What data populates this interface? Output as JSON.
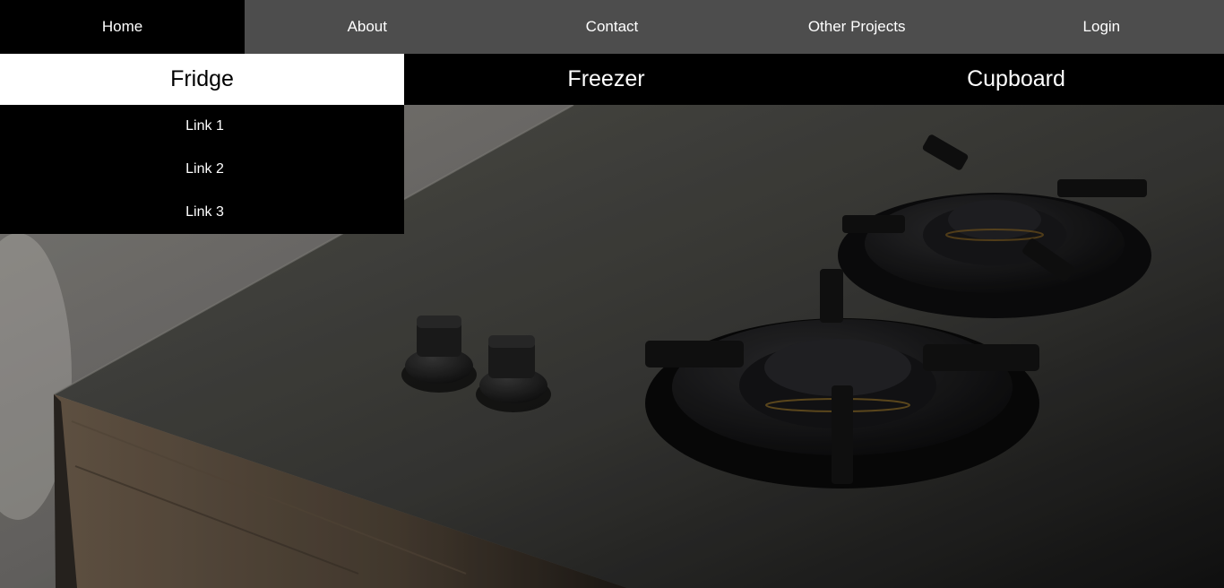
{
  "topnav": {
    "items": [
      {
        "label": "Home",
        "active": true
      },
      {
        "label": "About",
        "active": false
      },
      {
        "label": "Contact",
        "active": false
      },
      {
        "label": "Other Projects",
        "active": false
      },
      {
        "label": "Login",
        "active": false
      }
    ]
  },
  "categories": {
    "items": [
      {
        "label": "Fridge",
        "open": true
      },
      {
        "label": "Freezer",
        "open": false
      },
      {
        "label": "Cupboard",
        "open": false
      }
    ]
  },
  "dropdown": {
    "links": [
      "Link 1",
      "Link 2",
      "Link 3"
    ]
  },
  "hero": {
    "icon": "gas-stove-photo"
  },
  "colors": {
    "nav_bg": "#4d4d4d",
    "active_bg": "#000000",
    "category_bg": "#000000",
    "category_open_bg": "#ffffff",
    "text": "#ffffff"
  }
}
